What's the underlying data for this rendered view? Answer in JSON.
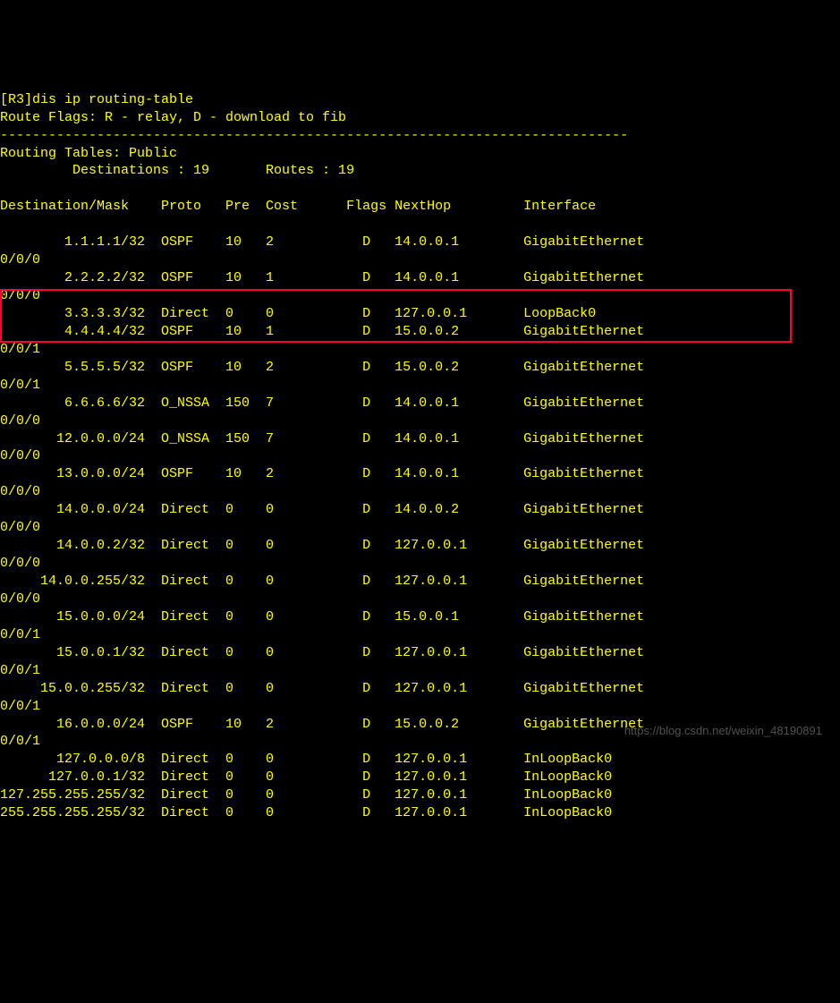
{
  "command_line": "[R3]dis ip routing-table",
  "flags_legend": "Route Flags: R - relay, D - download to fib",
  "divider": "------------------------------------------------------------------------------",
  "table_title": "Routing Tables: Public",
  "summary": "         Destinations : 19       Routes : 19",
  "header_row": "Destination/Mask    Proto   Pre  Cost      Flags NextHop         Interface",
  "rows": [
    {
      "dest": "        1.1.1.1/32",
      "proto": "OSPF  ",
      "pre": "10 ",
      "cost": "2",
      "flags": "D",
      "next": "14.0.0.1 ",
      "iface": "GigabitEthernet",
      "suffix": "0/0/0"
    },
    {
      "dest": "        2.2.2.2/32",
      "proto": "OSPF  ",
      "pre": "10 ",
      "cost": "1",
      "flags": "D",
      "next": "14.0.0.1 ",
      "iface": "GigabitEthernet",
      "suffix": "0/0/0"
    },
    {
      "dest": "        3.3.3.3/32",
      "proto": "Direct",
      "pre": "0  ",
      "cost": "0",
      "flags": "D",
      "next": "127.0.0.1",
      "iface": "LoopBack0",
      "suffix": ""
    },
    {
      "dest": "        4.4.4.4/32",
      "proto": "OSPF  ",
      "pre": "10 ",
      "cost": "1",
      "flags": "D",
      "next": "15.0.0.2 ",
      "iface": "GigabitEthernet",
      "suffix": "0/0/1"
    },
    {
      "dest": "        5.5.5.5/32",
      "proto": "OSPF  ",
      "pre": "10 ",
      "cost": "2",
      "flags": "D",
      "next": "15.0.0.2 ",
      "iface": "GigabitEthernet",
      "suffix": "0/0/1"
    },
    {
      "dest": "        6.6.6.6/32",
      "proto": "O_NSSA",
      "pre": "150",
      "cost": "7",
      "flags": "D",
      "next": "14.0.0.1 ",
      "iface": "GigabitEthernet",
      "suffix": "0/0/0"
    },
    {
      "dest": "      12.0.0.0/24",
      "proto": "O_NSSA",
      "pre": "150",
      "cost": "7",
      "flags": "D",
      "next": "14.0.0.1 ",
      "iface": "GigabitEthernet",
      "suffix": "0/0/0"
    },
    {
      "dest": "      13.0.0.0/24",
      "proto": "OSPF  ",
      "pre": "10 ",
      "cost": "2",
      "flags": "D",
      "next": "14.0.0.1 ",
      "iface": "GigabitEthernet",
      "suffix": "0/0/0"
    },
    {
      "dest": "      14.0.0.0/24",
      "proto": "Direct",
      "pre": "0  ",
      "cost": "0",
      "flags": "D",
      "next": "14.0.0.2 ",
      "iface": "GigabitEthernet",
      "suffix": "0/0/0"
    },
    {
      "dest": "      14.0.0.2/32",
      "proto": "Direct",
      "pre": "0  ",
      "cost": "0",
      "flags": "D",
      "next": "127.0.0.1",
      "iface": "GigabitEthernet",
      "suffix": "0/0/0"
    },
    {
      "dest": "    14.0.0.255/32",
      "proto": "Direct",
      "pre": "0  ",
      "cost": "0",
      "flags": "D",
      "next": "127.0.0.1",
      "iface": "GigabitEthernet",
      "suffix": "0/0/0"
    },
    {
      "dest": "      15.0.0.0/24",
      "proto": "Direct",
      "pre": "0  ",
      "cost": "0",
      "flags": "D",
      "next": "15.0.0.1 ",
      "iface": "GigabitEthernet",
      "suffix": "0/0/1"
    },
    {
      "dest": "      15.0.0.1/32",
      "proto": "Direct",
      "pre": "0  ",
      "cost": "0",
      "flags": "D",
      "next": "127.0.0.1",
      "iface": "GigabitEthernet",
      "suffix": "0/0/1"
    },
    {
      "dest": "    15.0.0.255/32",
      "proto": "Direct",
      "pre": "0  ",
      "cost": "0",
      "flags": "D",
      "next": "127.0.0.1",
      "iface": "GigabitEthernet",
      "suffix": "0/0/1"
    },
    {
      "dest": "      16.0.0.0/24",
      "proto": "OSPF  ",
      "pre": "10 ",
      "cost": "2",
      "flags": "D",
      "next": "15.0.0.2 ",
      "iface": "GigabitEthernet",
      "suffix": "0/0/1"
    },
    {
      "dest": "      127.0.0.0/8",
      "proto": "Direct",
      "pre": "0  ",
      "cost": "0",
      "flags": "D",
      "next": "127.0.0.1",
      "iface": "InLoopBack0",
      "suffix": ""
    },
    {
      "dest": "     127.0.0.1/32",
      "proto": "Direct",
      "pre": "0  ",
      "cost": "0",
      "flags": "D",
      "next": "127.0.0.1",
      "iface": "InLoopBack0",
      "suffix": ""
    },
    {
      "dest": "127.255.255.255/32",
      "proto": "Direct",
      "pre": "0  ",
      "cost": "0",
      "flags": "D",
      "next": "127.0.0.1",
      "iface": "InLoopBack0",
      "suffix": ""
    },
    {
      "dest": "255.255.255.255/32",
      "proto": "Direct",
      "pre": "0  ",
      "cost": "0",
      "flags": "D",
      "next": "127.0.0.1",
      "iface": "InLoopBack0",
      "suffix": ""
    }
  ],
  "watermark": "https://blog.csdn.net/weixin_48190891"
}
